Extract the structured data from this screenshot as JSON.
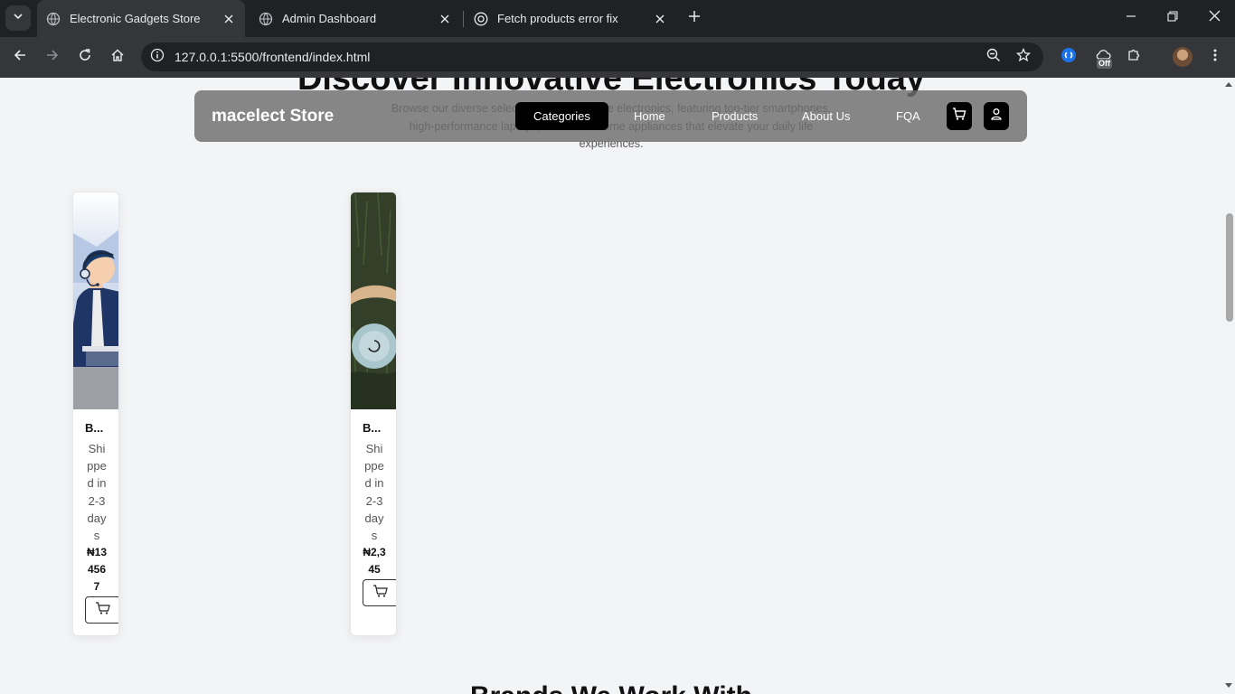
{
  "browser": {
    "tabs": [
      {
        "title": "Electronic Gadgets Store",
        "active": true
      },
      {
        "title": "Admin Dashboard",
        "active": false
      },
      {
        "title": "Fetch products error fix",
        "active": false
      }
    ],
    "url": "127.0.0.1:5500/frontend/index.html",
    "extension_badge": "Off"
  },
  "page": {
    "hero_title": "Discover Innovative Electronics Today",
    "hero_subtitle": "Browse our diverse selection of cutting-edge electronics, featuring top-tier smartphones, high-performance laptops, and smart home appliances that elevate your daily life experiences.",
    "nav": {
      "brand": "macelect Store",
      "links": [
        "Categories",
        "Home",
        "Products",
        "About Us",
        "FQA"
      ],
      "active": "Categories"
    },
    "products": [
      {
        "name": "B...",
        "shipping": "Shipped in 2-3 days",
        "price": "₦134567"
      },
      {
        "name": "B...",
        "shipping": "Shipped in 2-3 days",
        "price": "₦2,345"
      }
    ],
    "section_title": "Brands We Work With"
  },
  "colors": {
    "navbar_bg": "#6e6e6e",
    "active_link_bg": "#000000",
    "page_bg": "#f3f4f6"
  }
}
